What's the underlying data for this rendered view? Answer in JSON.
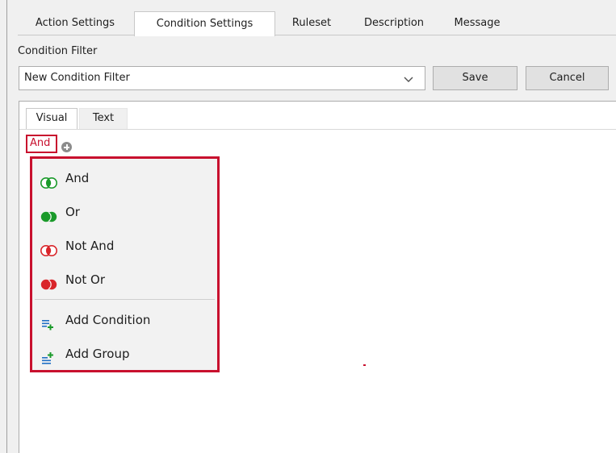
{
  "tabs": [
    {
      "label": "Action Settings"
    },
    {
      "label": "Condition Settings"
    },
    {
      "label": "Ruleset"
    },
    {
      "label": "Description"
    },
    {
      "label": "Message"
    }
  ],
  "condition_filter": {
    "label": "Condition Filter",
    "selected": "New Condition Filter",
    "save_label": "Save",
    "cancel_label": "Cancel"
  },
  "inner_tabs": [
    {
      "label": "Visual"
    },
    {
      "label": "Text"
    }
  ],
  "root_operator": "And",
  "menu": {
    "items": [
      {
        "label": "And",
        "icon": "and-operator-icon"
      },
      {
        "label": "Or",
        "icon": "or-operator-icon"
      },
      {
        "label": "Not And",
        "icon": "not-and-operator-icon"
      },
      {
        "label": "Not Or",
        "icon": "not-or-operator-icon"
      },
      {
        "label": "Add Condition",
        "icon": "add-condition-icon"
      },
      {
        "label": "Add Group",
        "icon": "add-group-icon"
      }
    ]
  },
  "colors": {
    "highlight": "#c8102e",
    "green": "#1a9a2a",
    "red": "#d9252a",
    "blue": "#1f6fc5"
  }
}
